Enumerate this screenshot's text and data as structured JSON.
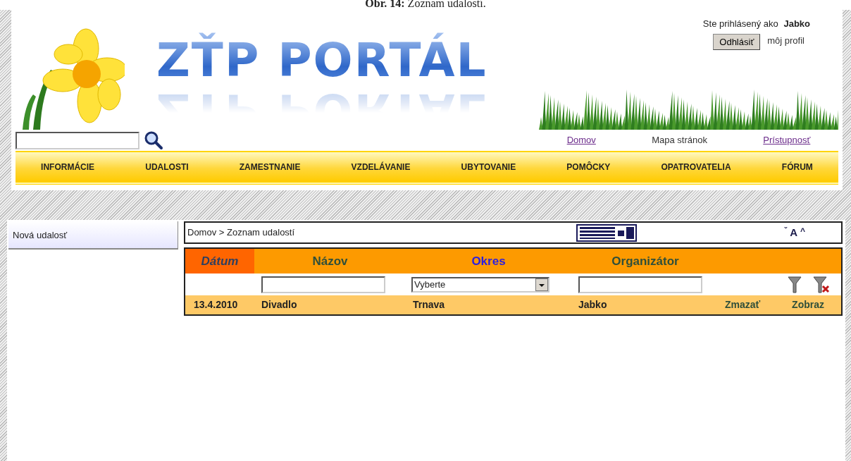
{
  "caption": "**Obr. 14:** Zoznam udalostí.",
  "user": {
    "label": "Ste prihlásený ako",
    "name": "Jabko",
    "logout_button": "Odhlásiť",
    "profile_link": "môj profil"
  },
  "logo": "ZŤP PORTÁL",
  "top_links": [
    {
      "label": "Domov",
      "visited": true
    },
    {
      "label": "Mapa stránok",
      "visited": false
    },
    {
      "label": "Prístupnosť",
      "visited": true
    }
  ],
  "menu": [
    "INFORMÁCIE",
    "UDALOSTI",
    "ZAMESTNANIE",
    "VZDELÁVANIE",
    "UBYTOVANIE",
    "POMÔCKY",
    "OPATROVATELIA",
    "FÓRUM"
  ],
  "sidebar": {
    "items": [
      {
        "label": "Nová udalosť"
      }
    ]
  },
  "breadcrumb": "Domov > Zoznam udalostí",
  "font_controls": [
    "ˇ",
    "A",
    "^"
  ],
  "table": {
    "columns": [
      {
        "label": "Dátum",
        "sorted": true,
        "link": false
      },
      {
        "label": "Názov",
        "sorted": false,
        "link": false
      },
      {
        "label": "Okres",
        "sorted": false,
        "link": true
      },
      {
        "label": "Organizátor",
        "sorted": false,
        "link": false
      }
    ],
    "filters": [
      {
        "kind": "none"
      },
      {
        "kind": "text"
      },
      {
        "kind": "select",
        "value": "Vyberte"
      },
      {
        "kind": "text"
      }
    ],
    "rows": [
      {
        "cells": [
          "13.4.2010",
          "Divadlo",
          "Trnava",
          "Jabko"
        ],
        "actions": [
          "Zmazať",
          "Zobraz"
        ]
      }
    ]
  }
}
